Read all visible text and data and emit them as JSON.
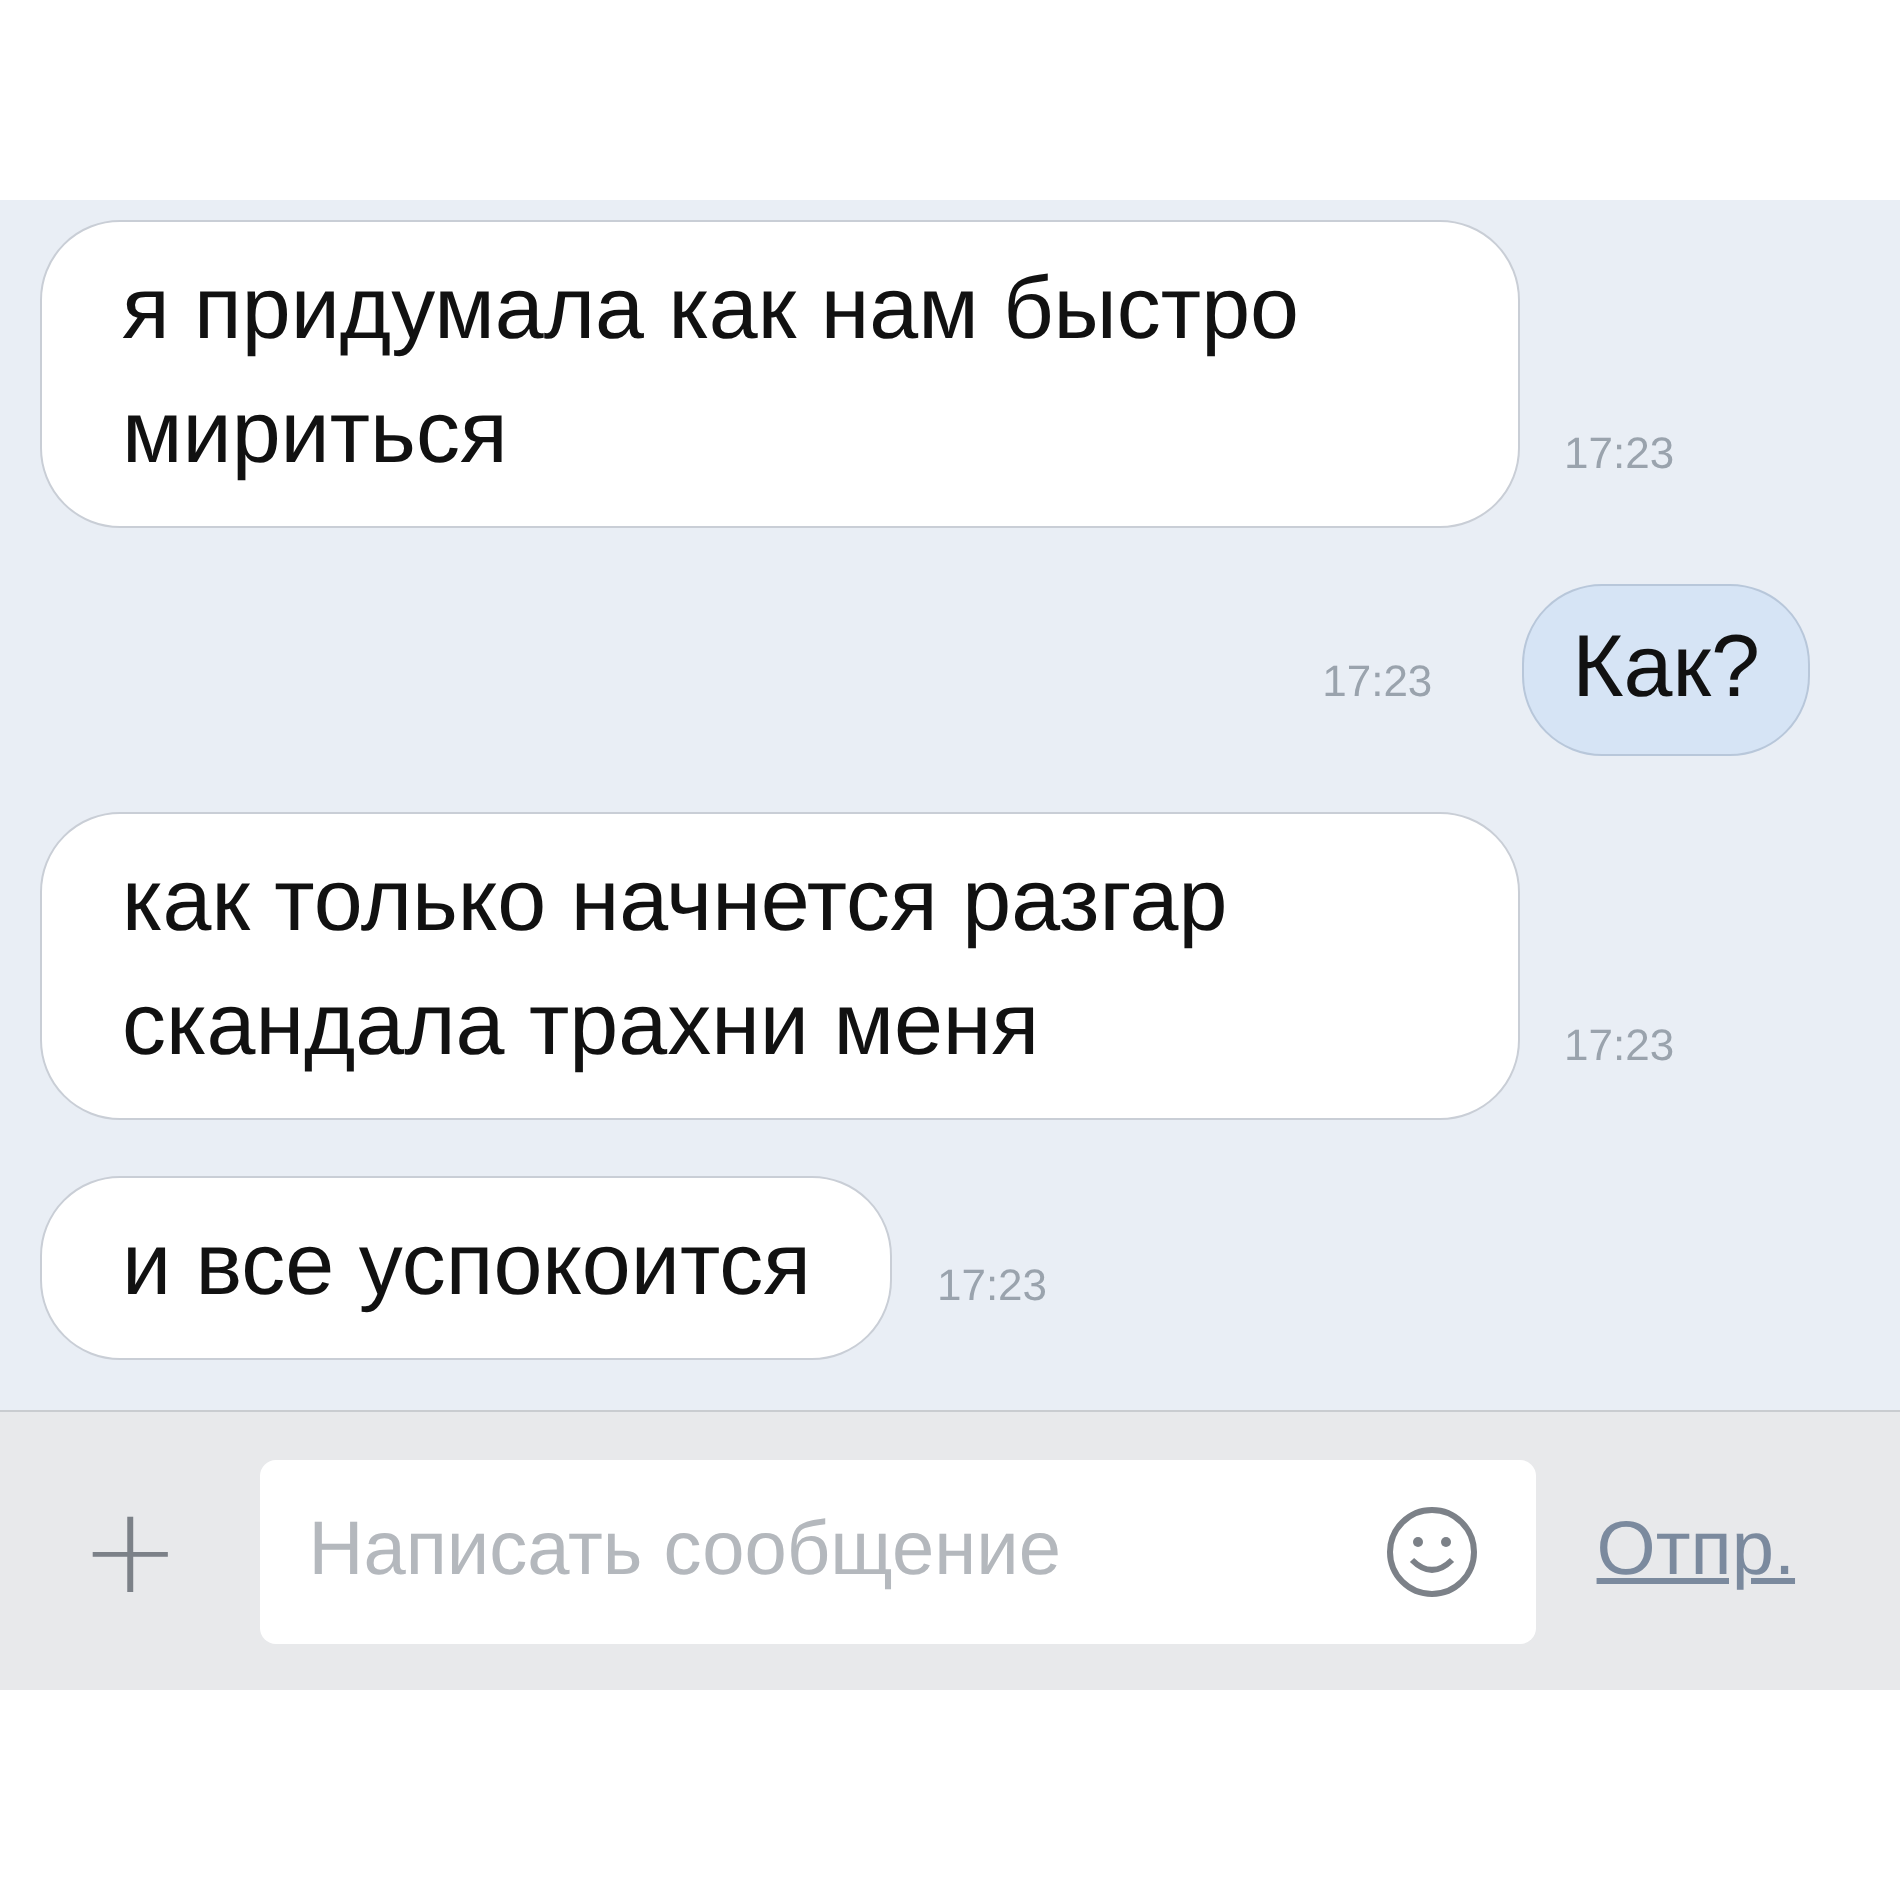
{
  "messages": [
    {
      "kind": "incoming",
      "text": "я придумала как нам быстро мириться",
      "time": "17:23"
    },
    {
      "kind": "outgoing",
      "text": "Как?",
      "time": "17:23"
    },
    {
      "kind": "incoming",
      "text": "как только начнется разгар скандала трахни меня",
      "time": "17:23"
    },
    {
      "kind": "incoming",
      "text": "и все успокоится",
      "time": "17:23"
    }
  ],
  "composer": {
    "add": "+",
    "placeholder": "Написать сообщение",
    "send": "Отпр."
  }
}
